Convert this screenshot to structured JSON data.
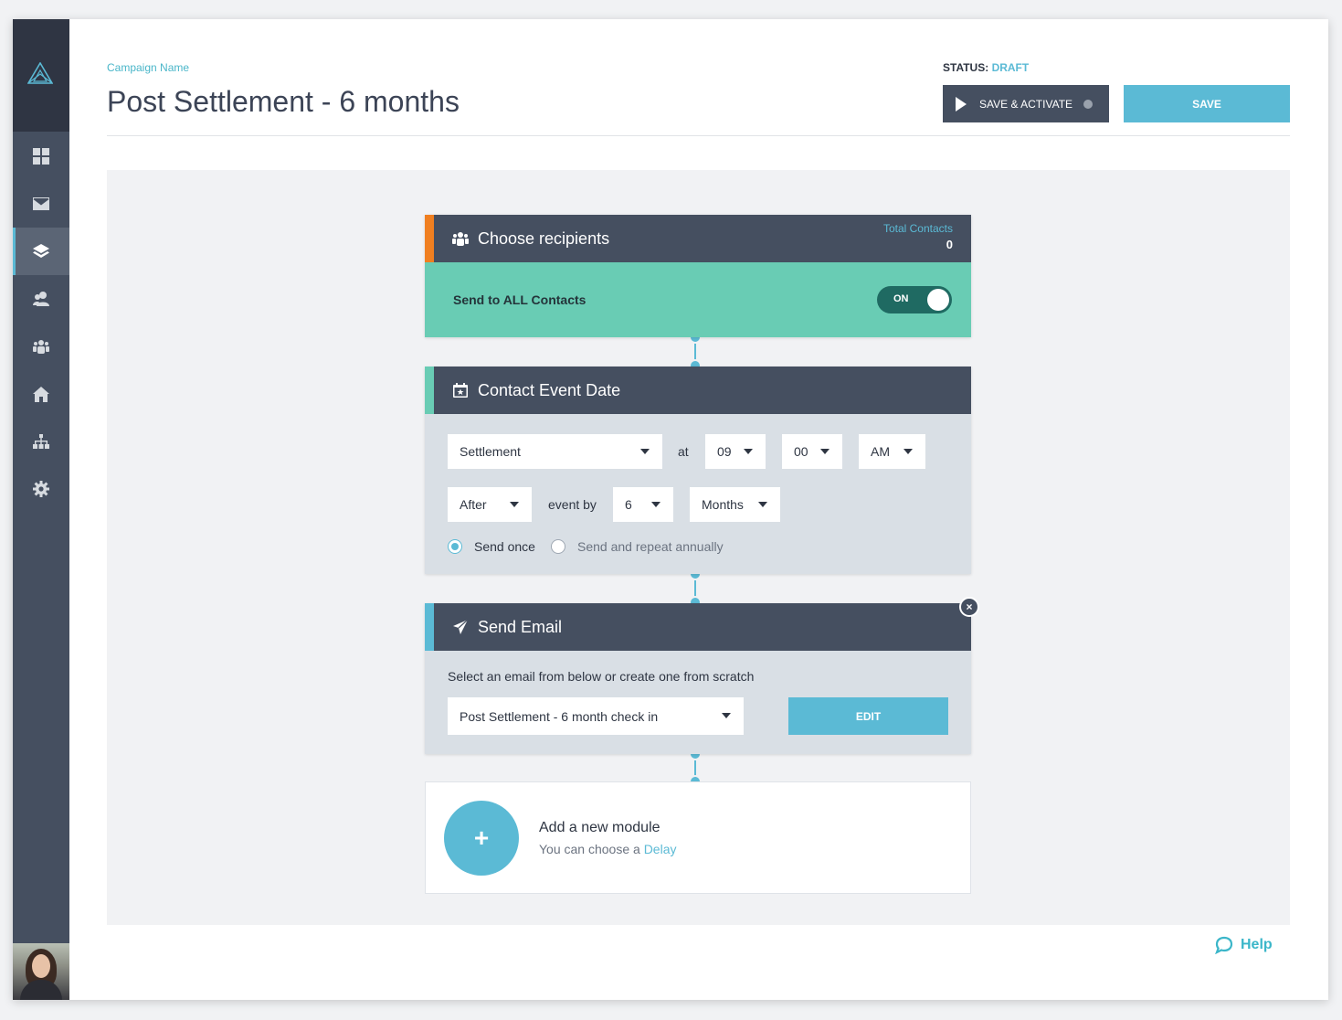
{
  "header": {
    "campaign_label": "Campaign Name",
    "title": "Post Settlement - 6 months",
    "status_label": "STATUS:",
    "status_value": "DRAFT",
    "save_activate_label": "SAVE & ACTIVATE",
    "save_label": "SAVE"
  },
  "sidebar": {
    "items": [
      {
        "icon": "dashboard-icon",
        "active": false
      },
      {
        "icon": "mail-icon",
        "active": false
      },
      {
        "icon": "layers-icon",
        "active": true
      },
      {
        "icon": "contacts-icon",
        "active": false
      },
      {
        "icon": "group-icon",
        "active": false
      },
      {
        "icon": "home-icon",
        "active": false
      },
      {
        "icon": "org-chart-icon",
        "active": false
      },
      {
        "icon": "gear-icon",
        "active": false
      }
    ]
  },
  "modules": {
    "recipients": {
      "title": "Choose recipients",
      "total_label": "Total Contacts",
      "total_value": "0",
      "send_all_label": "Send to ALL Contacts",
      "toggle_label": "ON"
    },
    "event_date": {
      "title": "Contact Event Date",
      "event": "Settlement",
      "at_label": "at",
      "hour": "09",
      "minute": "00",
      "ampm": "AM",
      "direction": "After",
      "event_by_label": "event by",
      "offset": "6",
      "unit": "Months",
      "radio_once": "Send once",
      "radio_repeat": "Send and repeat annually"
    },
    "send_email": {
      "title": "Send Email",
      "hint": "Select an email from below or create one from scratch",
      "email": "Post Settlement - 6 month check in",
      "edit_label": "EDIT",
      "close_glyph": "×"
    },
    "add_module": {
      "plus": "+",
      "title": "Add a new module",
      "sub_prefix": "You can choose a",
      "sub_link": "Delay"
    }
  },
  "help_label": "Help",
  "colors": {
    "accent": "#5bbad5",
    "dark": "#454f60",
    "green": "#69ccb4",
    "orange_stripe": "#f07f20",
    "green_stripe": "#69ccb4",
    "blue_stripe": "#5bbad5"
  }
}
